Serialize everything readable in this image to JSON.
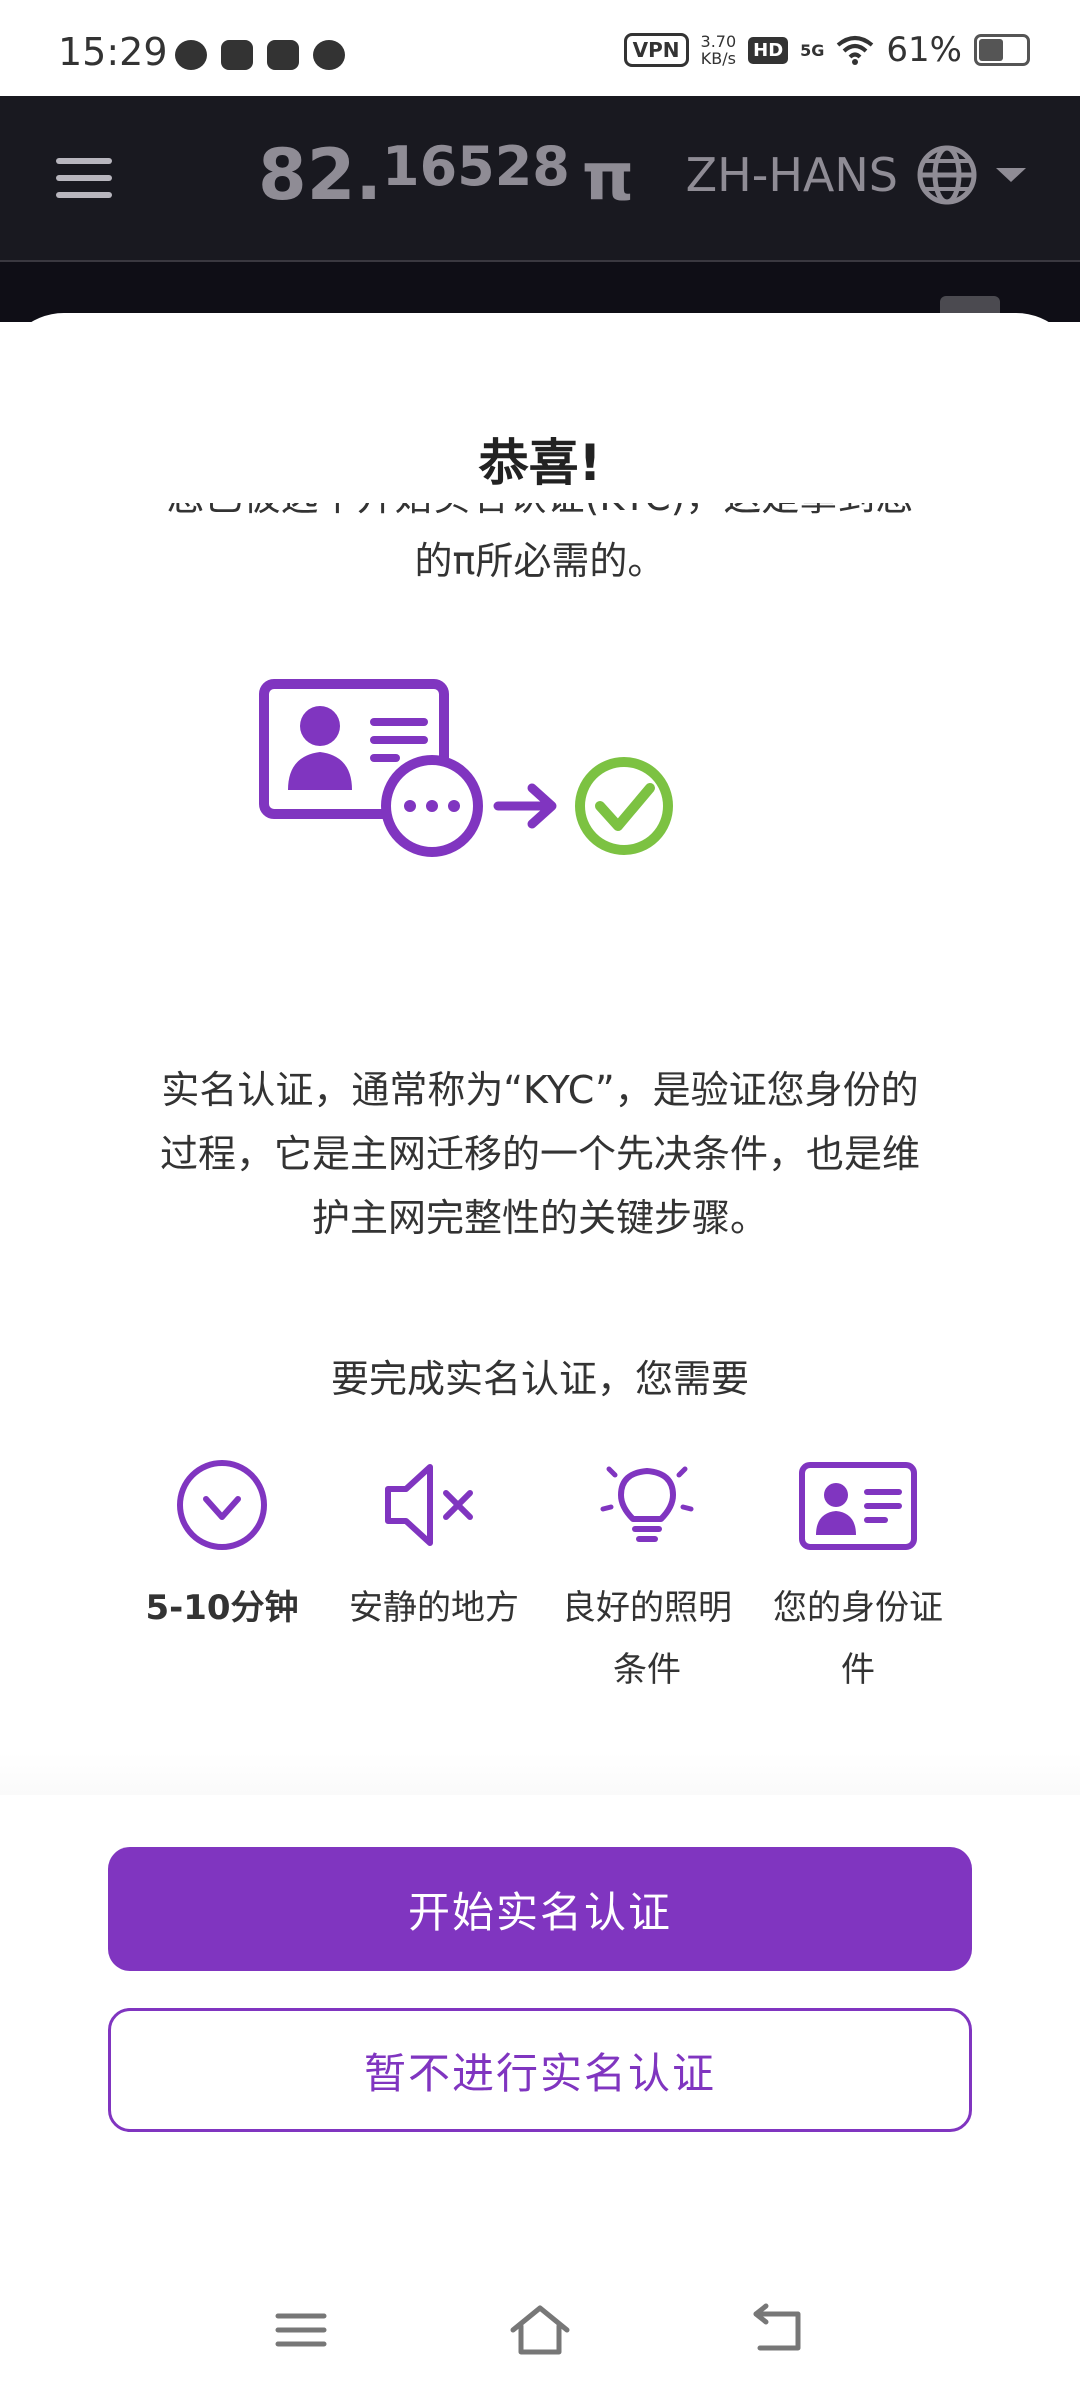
{
  "status_bar": {
    "time": "15:29",
    "vpn": "VPN",
    "speed_value": "3.70",
    "speed_unit": "KB/s",
    "hd": "HD",
    "network": "5G",
    "battery": "61%",
    "battery_level": 0.61,
    "notification_icons": [
      "wechat-icon",
      "gallery-icon",
      "tiktok-icon",
      "message-icon"
    ]
  },
  "header": {
    "balance_int": "82.",
    "balance_dec": "16528",
    "currency_symbol": "π",
    "language": "ZH-HANS"
  },
  "modal": {
    "title": "恭喜!",
    "intro": "您已被选中开始实名认证(KYC)，这是拿到您的π所必需的。",
    "body": "实名认证，通常称为“KYC”，是验证您身份的过程，它是主网迁移的一个先决条件，也是维护主网完整性的关键步骤。",
    "requirements_lead": "要完成实名认证，您需要",
    "requirements": [
      {
        "icon": "clock-icon",
        "label": "5-10分钟"
      },
      {
        "icon": "speaker-muted-icon",
        "label": "安静的地方"
      },
      {
        "icon": "lightbulb-icon",
        "label": "良好的照明条件"
      },
      {
        "icon": "id-card-icon",
        "label": "您的身份证件"
      }
    ],
    "start_button": "开始实名认证",
    "skip_button": "暂不进行实名认证"
  },
  "colors": {
    "accent": "#8035C0",
    "success": "#7CC242",
    "header_bg": "#191920"
  }
}
